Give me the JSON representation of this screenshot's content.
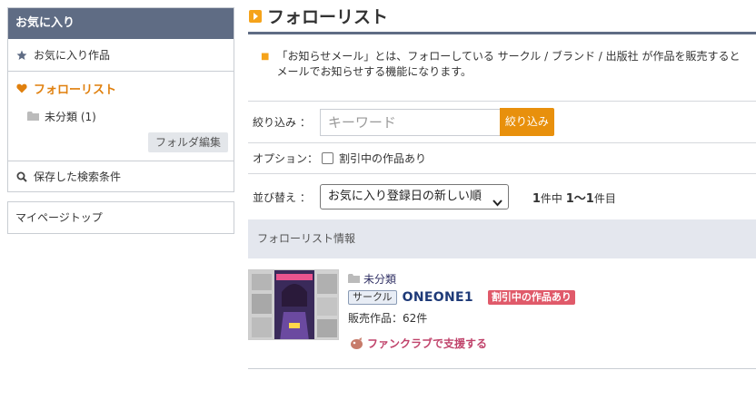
{
  "sidebar": {
    "header": "お気に入り",
    "favorites_label": "お気に入り作品",
    "follow_label": "フォローリスト",
    "folder_label": "未分類 (1)",
    "folder_edit_label": "フォルダ編集",
    "saved_search_label": "保存した検索条件",
    "mypage_label": "マイページトップ"
  },
  "main": {
    "title": "フォローリスト",
    "notice": "「お知らせメール」とは、フォローしている サークル / ブランド / 出版社 が作品を販売するとメールでお知らせする機能になります。",
    "filter": {
      "label": "絞り込み ：",
      "placeholder": "キーワード",
      "button": "絞り込み"
    },
    "option": {
      "label": "オプション：",
      "checkbox_label": "割引中の作品あり",
      "checked": false
    },
    "sort": {
      "label": "並び替え ：",
      "selected": "お気に入り登録日の新しい順",
      "count_total": "1",
      "count_suffix1": "件中",
      "count_range": "1〜1",
      "count_suffix2": "件目"
    },
    "info_header": "フォローリスト情報",
    "items": [
      {
        "folder": "未分類",
        "tag": "サークル",
        "name": "ONEONE1",
        "badge": "割引中の作品あり",
        "works": "販売作品：62件",
        "fanclub": "ファンクラブで支援する"
      }
    ]
  },
  "colors": {
    "sidebar_header": "#5f6c84",
    "accent_orange": "#e8900c",
    "follow_orange": "#e0800e",
    "circle_name": "#1e3a78",
    "sale_badge": "#e05a6a",
    "fanclub": "#c0436b"
  },
  "icons": [
    "star-icon",
    "heart-icon",
    "folder-icon",
    "search-icon",
    "chevron-down-icon",
    "fanclub-icon",
    "title-marker-icon"
  ]
}
